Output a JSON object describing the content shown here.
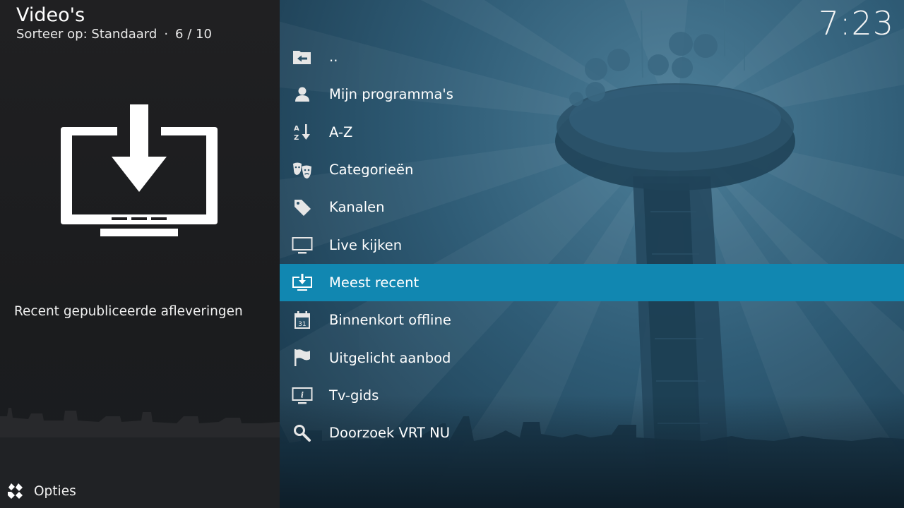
{
  "header": {
    "title": "Video's",
    "sort_label": "Sorteer op: Standaard",
    "separator": "·",
    "position": "6 / 10"
  },
  "clock": "7:23",
  "info_panel": {
    "icon": "monitor-download-icon",
    "description": "Recent gepubliceerde afleveringen"
  },
  "footer": {
    "options_label": "Opties",
    "options_icon": "options-icon"
  },
  "list": {
    "selected_index": 6,
    "items": [
      {
        "label": "..",
        "icon": "folder-back-icon"
      },
      {
        "label": "Mijn programma's",
        "icon": "user-icon"
      },
      {
        "label": "A-Z",
        "icon": "sort-az-icon"
      },
      {
        "label": "Categorieën",
        "icon": "theater-masks-icon"
      },
      {
        "label": "Kanalen",
        "icon": "tag-icon"
      },
      {
        "label": "Live kijken",
        "icon": "tv-icon"
      },
      {
        "label": "Meest recent",
        "icon": "monitor-download-icon"
      },
      {
        "label": "Binnenkort offline",
        "icon": "calendar-icon"
      },
      {
        "label": "Uitgelicht aanbod",
        "icon": "flag-icon"
      },
      {
        "label": "Tv-gids",
        "icon": "tv-info-icon"
      },
      {
        "label": "Doorzoek VRT NU",
        "icon": "search-icon"
      }
    ]
  },
  "colors": {
    "selection": "#1187b1",
    "panel_bg": "#1d1d1f",
    "backdrop": "#2e5a74"
  }
}
